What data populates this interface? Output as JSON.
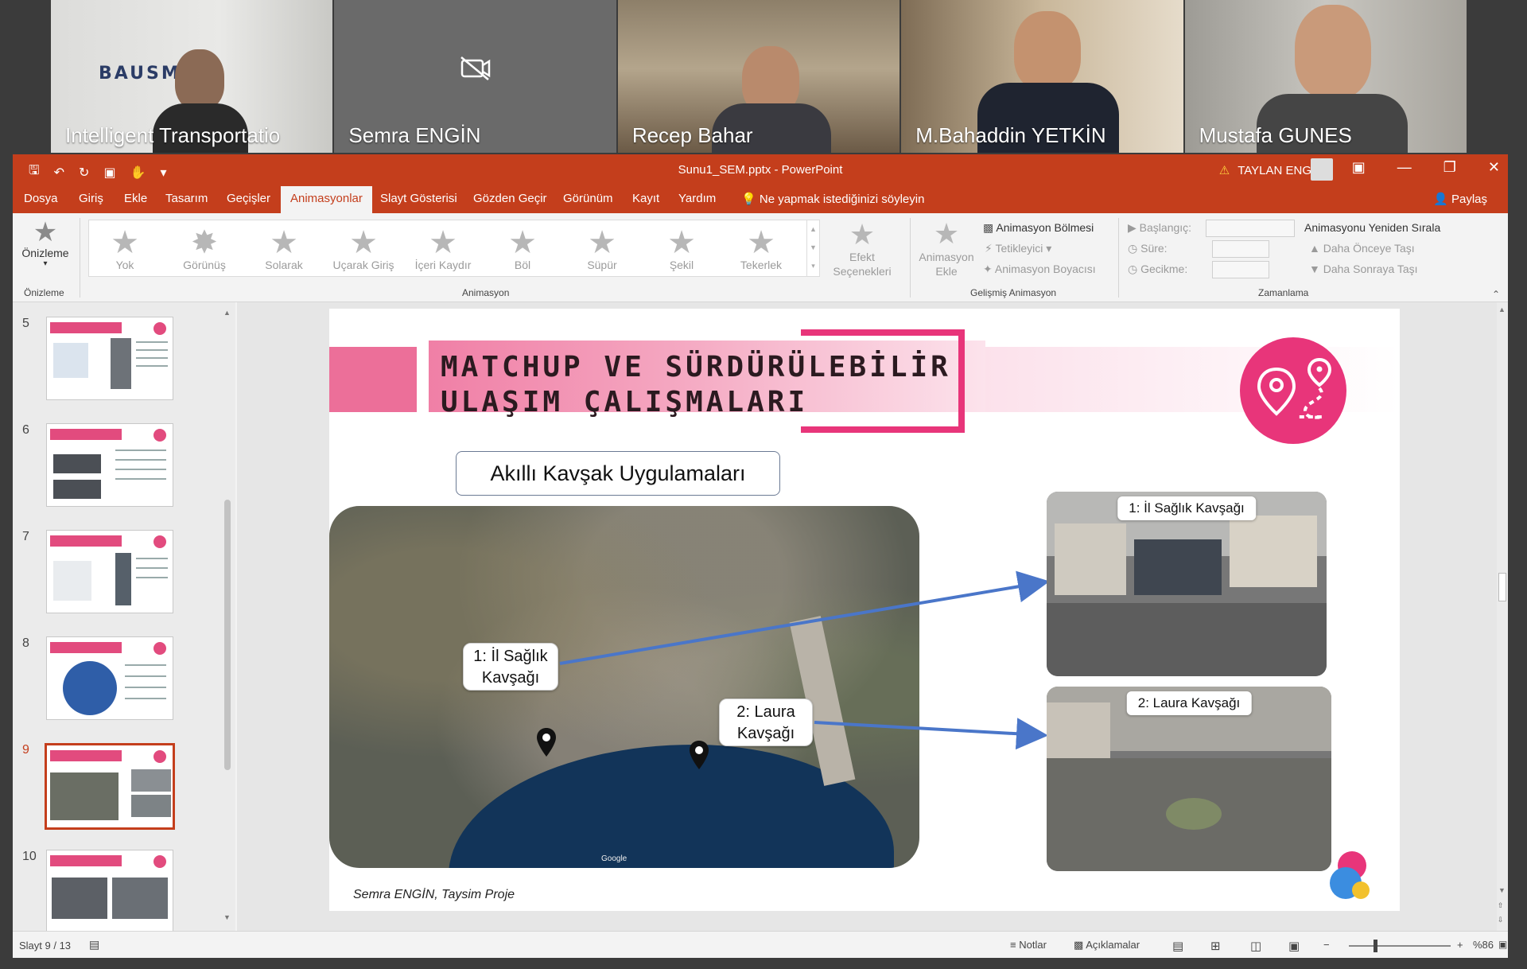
{
  "participants": [
    {
      "name": "Intelligent Transportatio",
      "bg": "#d9d9d6"
    },
    {
      "name": "Semra ENGİN",
      "bg": "#6b6b6b",
      "camera_off": true
    },
    {
      "name": "Recep Bahar",
      "bg": "#8a7f6e"
    },
    {
      "name": "M.Bahaddin YETKİN",
      "bg": "#9c8a74"
    },
    {
      "name": "Mustafa GUNES",
      "bg": "#b5b3ad"
    }
  ],
  "window": {
    "title": "Sunu1_SEM.pptx  -  PowerPoint",
    "user": "TAYLAN ENGİN",
    "accent": "#c43e1c"
  },
  "tabs": [
    "Dosya",
    "Giriş",
    "Ekle",
    "Tasarım",
    "Geçişler",
    "Animasyonlar",
    "Slayt Gösterisi",
    "Gözden Geçir",
    "Görünüm",
    "Kayıt",
    "Yardım"
  ],
  "active_tab": "Animasyonlar",
  "tell_me": "Ne yapmak istediğinizi söyleyin",
  "share": "Paylaş",
  "ribbon": {
    "preview_label": "Önizleme",
    "preview_group": "Önizleme",
    "animations": [
      "Yok",
      "Görünüş",
      "Solarak",
      "Uçarak Giriş",
      "İçeri Kaydır",
      "Böl",
      "Süpür",
      "Şekil",
      "Tekerlek"
    ],
    "effect_options": "Efekt Seçenekleri",
    "animation_group": "Animasyon",
    "add_animation": "Animasyon Ekle",
    "animation_pane": "Animasyon Bölmesi",
    "trigger": "Tetikleyici",
    "animation_painter": "Animasyon Boyacısı",
    "advanced_group": "Gelişmiş Animasyon",
    "start": "Başlangıç:",
    "duration": "Süre:",
    "delay": "Gecikme:",
    "reorder": "Animasyonu Yeniden Sırala",
    "move_earlier": "Daha Önceye Taşı",
    "move_later": "Daha Sonraya Taşı",
    "timing_group": "Zamanlama"
  },
  "thumbnails": [
    "5",
    "6",
    "7",
    "8",
    "9",
    "10"
  ],
  "active_slide": "9",
  "slide": {
    "title_line1": "MATCHUP VE SÜRDÜRÜLEBİLİR",
    "title_line2": "ULAŞIM ÇALIŞMALARI",
    "subtitle": "Akıllı Kavşak Uygulamaları",
    "callout1_line1": "1: İl Sağlık",
    "callout1_line2": "Kavşağı",
    "callout2_line1": "2: Laura",
    "callout2_line2": "Kavşağı",
    "photo1_label": "1: İl Sağlık Kavşağı",
    "photo2_label": "2: Laura Kavşağı",
    "map_credit": "Google",
    "footer": "Semra ENGİN, Taysim Proje",
    "pink": "#e8357a",
    "arrow_color": "#4a76c9"
  },
  "status": {
    "slide_counter": "Slayt 9 / 13",
    "notes": "Notlar",
    "comments": "Açıklamalar",
    "zoom": "%86"
  }
}
